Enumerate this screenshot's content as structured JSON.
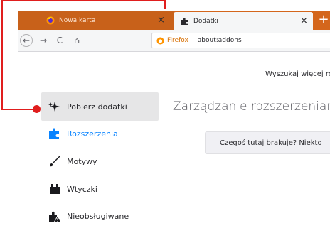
{
  "tabs": [
    {
      "title": "Nowa karta",
      "favicon": "firefox-icon",
      "active": false
    },
    {
      "title": "Dodatki",
      "favicon": "puzzle-icon",
      "active": true
    }
  ],
  "tab_close_glyph": "×",
  "new_tab_glyph": "+",
  "navbar": {
    "back_glyph": "←",
    "forward_glyph": "→",
    "reload_glyph": "C",
    "home_glyph": "⌂",
    "url_identity_label": "Firefox",
    "url": "about:addons"
  },
  "page": {
    "search_text": "Wyszukaj więcej roz",
    "heading": "Zarządzanie rozszerzeniami",
    "notice": "Czegoś tutaj brakuje? Niekto"
  },
  "sidebar": {
    "items": [
      {
        "label": "Pobierz dodatki",
        "icon": "sparkle-icon",
        "selected": true
      },
      {
        "label": "Rozszerzenia",
        "icon": "puzzle-icon",
        "selected": false
      },
      {
        "label": "Motywy",
        "icon": "brush-icon",
        "selected": false
      },
      {
        "label": "Wtyczki",
        "icon": "plugin-icon",
        "selected": false
      },
      {
        "label": "Nieobsługiwane",
        "icon": "unsupported-icon",
        "selected": false
      }
    ]
  },
  "colors": {
    "tabstrip": "#d4661c",
    "accent_blue": "#0a84ff",
    "callout_red": "#e01e1e"
  }
}
